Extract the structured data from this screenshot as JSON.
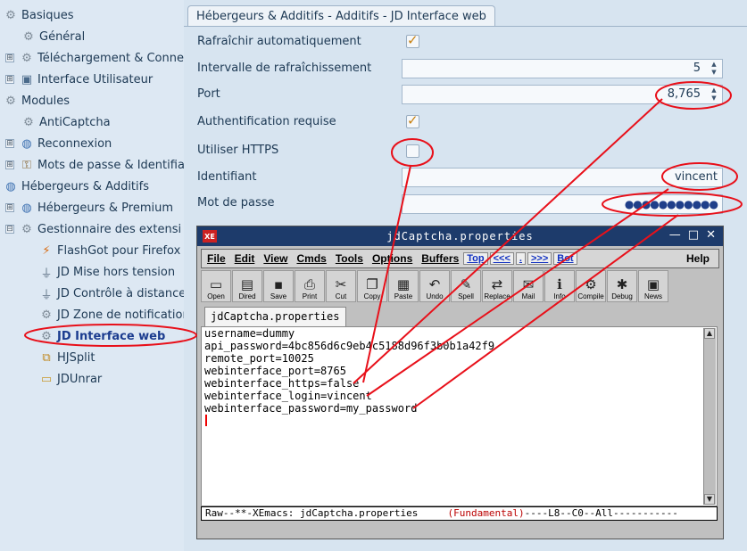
{
  "tree": {
    "items": [
      {
        "label": "Basiques",
        "expander": "",
        "icon": "gear"
      },
      {
        "label": "Général",
        "expander": "",
        "icon": "gear"
      },
      {
        "label": "Téléchargement & Conne",
        "expander": "⊞",
        "icon": "gear"
      },
      {
        "label": "Interface Utilisateur",
        "expander": "⊞",
        "icon": "monitor"
      },
      {
        "label": "Modules",
        "expander": "",
        "icon": "gear"
      },
      {
        "label": "AntiCaptcha",
        "expander": "",
        "icon": "gear"
      },
      {
        "label": "Reconnexion",
        "expander": "⊞",
        "icon": "globe"
      },
      {
        "label": "Mots de passe & Identifia",
        "expander": "⊞",
        "icon": "key"
      },
      {
        "label": "Hébergeurs & Additifs",
        "expander": "",
        "icon": "globe"
      },
      {
        "label": "Hébergeurs & Premium",
        "expander": "⊞",
        "icon": "globe"
      },
      {
        "label": "Gestionnaire des extensi",
        "expander": "⊟",
        "icon": "gear"
      },
      {
        "label": "FlashGot pour Firefox",
        "expander": "",
        "icon": "flashgot"
      },
      {
        "label": "JD Mise hors tension",
        "expander": "",
        "icon": "plug"
      },
      {
        "label": "JD Contrôle à distance",
        "expander": "",
        "icon": "plug"
      },
      {
        "label": "JD Zone de notification",
        "expander": "",
        "icon": "gear"
      },
      {
        "label": "JD Interface web",
        "expander": "",
        "icon": "gear",
        "selected": true
      },
      {
        "label": "HJSplit",
        "expander": "",
        "icon": "hjsplit"
      },
      {
        "label": "JDUnrar",
        "expander": "",
        "icon": "box"
      }
    ]
  },
  "panel": {
    "tab_title": "Hébergeurs & Additifs - Additifs - JD Interface web",
    "rows": {
      "auto_refresh_label": "Rafraîchir automatiquement",
      "refresh_interval_label": "Intervalle de rafraîchissement",
      "refresh_interval_value": "5",
      "port_label": "Port",
      "port_value": "8,765",
      "auth_label": "Authentification requise",
      "https_label": "Utiliser HTTPS",
      "login_label": "Identifiant",
      "login_value": "vincent",
      "password_label": "Mot de passe",
      "password_value": "●●●●●●●●●●●"
    },
    "checks": {
      "auto_refresh": true,
      "auth_required": true,
      "use_https": false
    }
  },
  "xemacs": {
    "title": "jdCaptcha.properties",
    "logo": "XE",
    "window_buttons": [
      "—",
      "□",
      "✕"
    ],
    "menu": [
      "File",
      "Edit",
      "View",
      "Cmds",
      "Tools",
      "Options",
      "Buffers"
    ],
    "nav": [
      "Top",
      "<<<",
      ".",
      ">>>",
      "Bot"
    ],
    "help": "Help",
    "toolbar": [
      {
        "label": "Open",
        "icon": "open-icon"
      },
      {
        "label": "Dired",
        "icon": "dired-icon"
      },
      {
        "label": "Save",
        "icon": "save-icon"
      },
      {
        "label": "Print",
        "icon": "print-icon"
      },
      {
        "label": "Cut",
        "icon": "cut-icon"
      },
      {
        "label": "Copy",
        "icon": "copy-icon"
      },
      {
        "label": "Paste",
        "icon": "paste-icon"
      },
      {
        "label": "Undo",
        "icon": "undo-icon"
      },
      {
        "label": "Spell",
        "icon": "spell-icon"
      },
      {
        "label": "Replace",
        "icon": "replace-icon"
      },
      {
        "label": "Mail",
        "icon": "mail-icon"
      },
      {
        "label": "Info",
        "icon": "info-icon"
      },
      {
        "label": "Compile",
        "icon": "compile-icon"
      },
      {
        "label": "Debug",
        "icon": "debug-icon"
      },
      {
        "label": "News",
        "icon": "news-icon"
      }
    ],
    "buffer_tab": "jdCaptcha.properties",
    "lines": [
      "username=dummy",
      "api_password=4bc856d6c9eb4c5188d96f3b0b1a42f9",
      "remote_port=10025",
      "webinterface_port=8765",
      "webinterface_https=false",
      "webinterface_login=vincent",
      "webinterface_password=my_password"
    ],
    "modeline_prefix": "Raw--**-XEmacs: jdCaptcha.properties     ",
    "modeline_mode": "(Fundamental)",
    "modeline_suffix": "----L8--C0--All-----------"
  },
  "colors": {
    "annotation_red": "#e8101a",
    "accent_check": "#c88010",
    "title_bg": "#1d3b6b"
  }
}
